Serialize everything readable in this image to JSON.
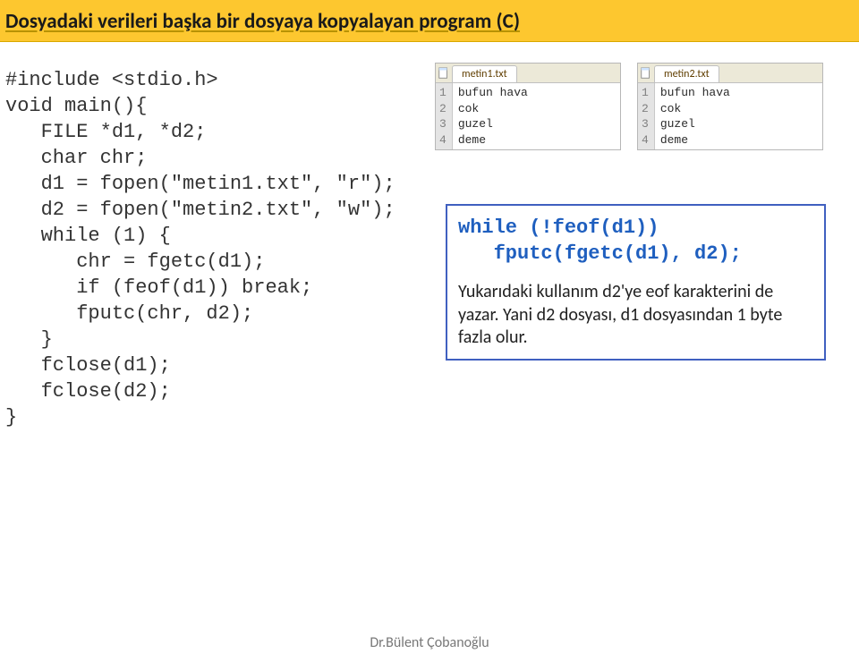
{
  "title": "Dosyadaki verileri başka bir dosyaya kopyalayan program (C)",
  "code": {
    "l1": "#include <stdio.h>",
    "l2": "void main(){",
    "l3": "   FILE *d1, *d2;",
    "l4": "   char chr;",
    "l5": "   d1 = fopen(\"metin1.txt\", \"r\");",
    "l6": "   d2 = fopen(\"metin2.txt\", \"w\");",
    "l7": "   while (1) {",
    "l8": "      chr = fgetc(d1);",
    "l9": "      if (feof(d1)) break;",
    "l10": "      fputc(chr, d2);",
    "l11": "   }",
    "l12": "   fclose(d1);",
    "l13": "   fclose(d2);",
    "l14": "}"
  },
  "editors": [
    {
      "tab": "metin1.txt",
      "lines": [
        "1",
        "2",
        "3",
        "4"
      ],
      "content": "bufun hava\ncok\nguzel\ndeme"
    },
    {
      "tab": "metin2.txt",
      "lines": [
        "1",
        "2",
        "3",
        "4"
      ],
      "content": "bufun hava\ncok\nguzel\ndeme"
    }
  ],
  "note": {
    "code1": "while (!feof(d1))",
    "code2": "   fputc(fgetc(d1), d2);",
    "text": "Yukarıdaki kullanım d2'ye eof karakterini de yazar. Yani d2 dosyası, d1 dosyasından 1 byte fazla olur."
  },
  "footer": "Dr.Bülent Çobanoğlu"
}
